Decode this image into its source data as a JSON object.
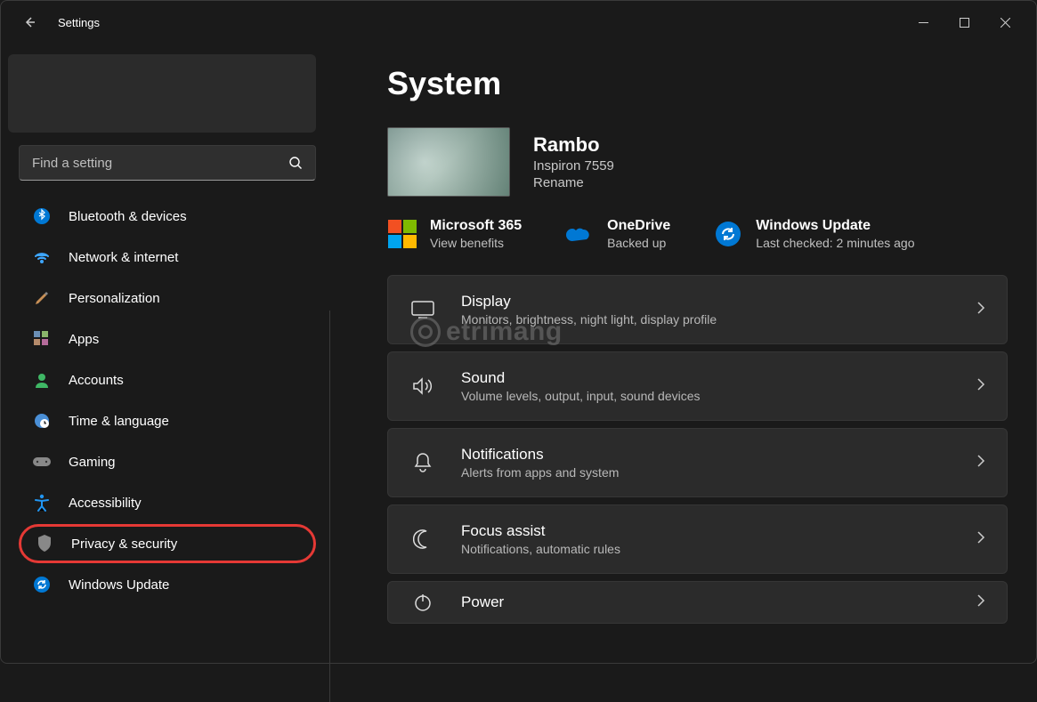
{
  "app": {
    "title": "Settings"
  },
  "search": {
    "placeholder": "Find a setting"
  },
  "sidebar": {
    "items": [
      {
        "label": "Bluetooth & devices"
      },
      {
        "label": "Network & internet"
      },
      {
        "label": "Personalization"
      },
      {
        "label": "Apps"
      },
      {
        "label": "Accounts"
      },
      {
        "label": "Time & language"
      },
      {
        "label": "Gaming"
      },
      {
        "label": "Accessibility"
      },
      {
        "label": "Privacy & security"
      },
      {
        "label": "Windows Update"
      }
    ]
  },
  "main": {
    "heading": "System",
    "device": {
      "name": "Rambo",
      "model": "Inspiron 7559",
      "rename": "Rename"
    },
    "status": [
      {
        "title": "Microsoft 365",
        "sub": "View benefits"
      },
      {
        "title": "OneDrive",
        "sub": "Backed up"
      },
      {
        "title": "Windows Update",
        "sub": "Last checked: 2 minutes ago"
      }
    ],
    "cards": [
      {
        "title": "Display",
        "desc": "Monitors, brightness, night light, display profile"
      },
      {
        "title": "Sound",
        "desc": "Volume levels, output, input, sound devices"
      },
      {
        "title": "Notifications",
        "desc": "Alerts from apps and system"
      },
      {
        "title": "Focus assist",
        "desc": "Notifications, automatic rules"
      },
      {
        "title": "Power",
        "desc": ""
      }
    ]
  },
  "watermark": "etrimang"
}
